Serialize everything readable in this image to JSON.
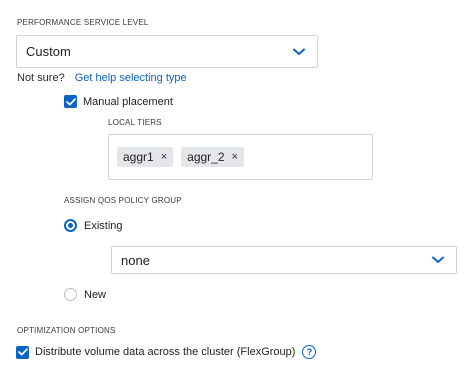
{
  "performance": {
    "section_label": "PERFORMANCE SERVICE LEVEL",
    "selected_value": "Custom",
    "not_sure_text": "Not sure?",
    "help_link": "Get help selecting type"
  },
  "manual_placement": {
    "label": "Manual placement",
    "checked": true
  },
  "local_tiers": {
    "section_label": "LOCAL TIERS",
    "chips": [
      {
        "label": "aggr1",
        "remove": "×"
      },
      {
        "label": "aggr_2",
        "remove": "×"
      }
    ]
  },
  "qos": {
    "section_label": "ASSIGN QOS POLICY GROUP",
    "options": [
      {
        "label": "Existing",
        "selected": true
      },
      {
        "label": "New",
        "selected": false
      }
    ],
    "policy_value": "none"
  },
  "optimization": {
    "section_label": "OPTIMIZATION OPTIONS",
    "distribute_label": "Distribute volume data across the cluster (FlexGroup)",
    "distribute_checked": true,
    "help_glyph": "?"
  },
  "colors": {
    "accent": "#0b63c5",
    "border": "#cfd3d8",
    "chip_bg": "#e4e7ea"
  },
  "icons": [
    "chevron-down-icon",
    "check-icon",
    "close-icon",
    "help-circle-icon"
  ]
}
